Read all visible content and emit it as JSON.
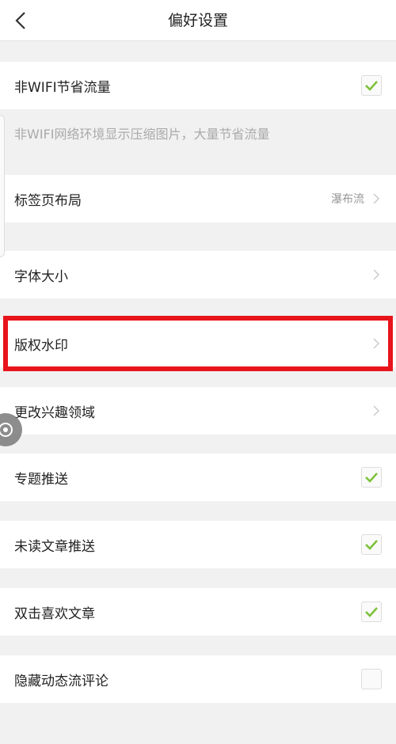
{
  "header": {
    "title": "偏好设置",
    "back_icon": "chevron-left-icon"
  },
  "settings": {
    "wifi_saver": {
      "label": "非WIFI节省流量",
      "checked": true
    },
    "wifi_saver_desc": "非WIFI网络环境显示压缩图片，大量节省流量",
    "tab_layout": {
      "label": "标签页布局",
      "value": "瀑布流"
    },
    "font_size": {
      "label": "字体大小"
    },
    "watermark": {
      "label": "版权水印"
    },
    "interests": {
      "label": "更改兴趣领域"
    },
    "topic_push": {
      "label": "专题推送",
      "checked": true
    },
    "unread_push": {
      "label": "未读文章推送",
      "checked": true
    },
    "double_tap_like": {
      "label": "双击喜欢文章",
      "checked": true
    },
    "hide_comments": {
      "label": "隐藏动态流评论",
      "checked": false
    }
  },
  "colors": {
    "check": "#7cc23a",
    "highlight": "#e8141b",
    "background": "#f1f1f1"
  }
}
